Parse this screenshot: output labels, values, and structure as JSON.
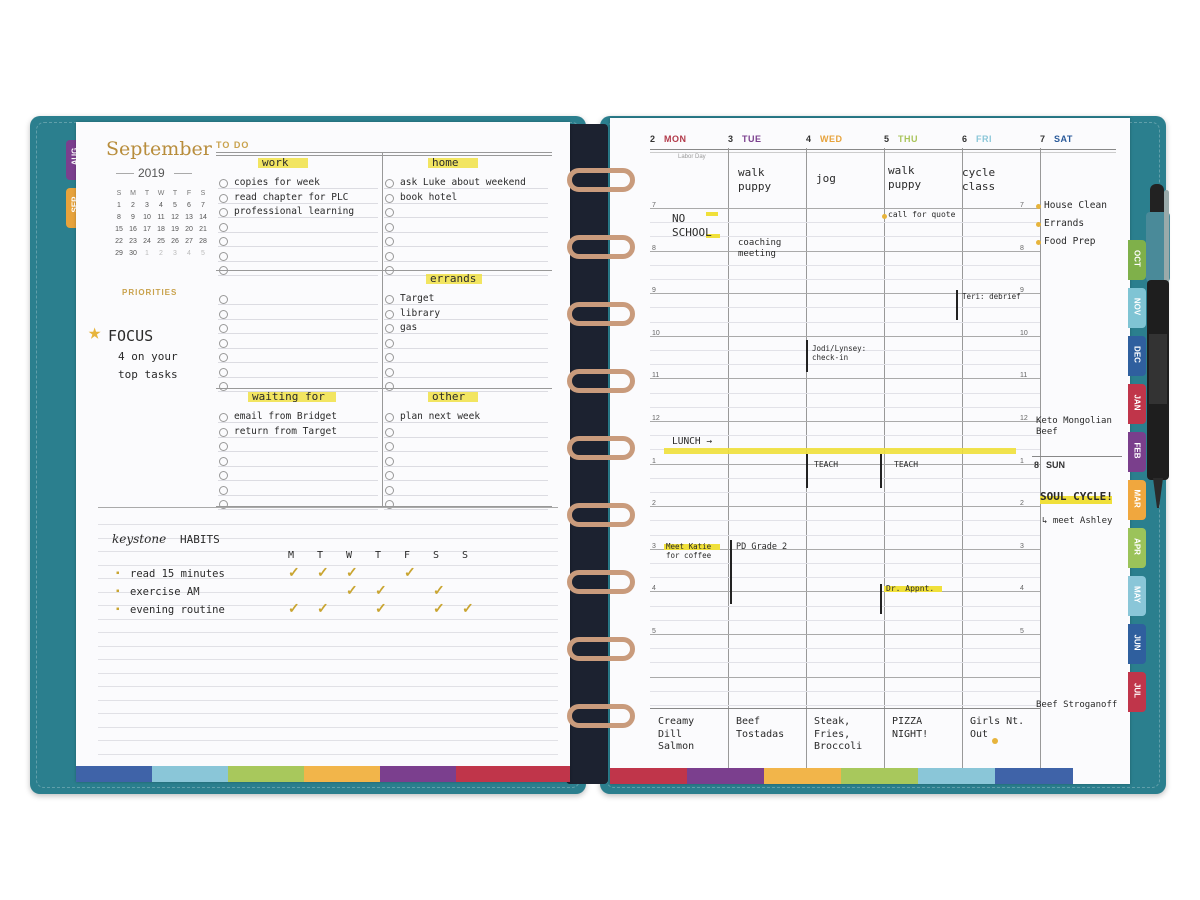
{
  "left_page": {
    "month_title": "September",
    "year": "2019",
    "calendar": {
      "weekdays": [
        "S",
        "M",
        "T",
        "W",
        "T",
        "F",
        "S"
      ],
      "rows": [
        [
          "1",
          "2",
          "3",
          "4",
          "5",
          "6",
          "7"
        ],
        [
          "8",
          "9",
          "10",
          "11",
          "12",
          "13",
          "14"
        ],
        [
          "15",
          "16",
          "17",
          "18",
          "19",
          "20",
          "21"
        ],
        [
          "22",
          "23",
          "24",
          "25",
          "26",
          "27",
          "28"
        ],
        [
          "29",
          "30",
          "1",
          "2",
          "3",
          "4",
          "5"
        ]
      ]
    },
    "todo_label": "TO DO",
    "priorities_label": "PRIORITIES",
    "focus_star": "★",
    "focus_text": "FOCUS",
    "focus_note_1": "4 on your",
    "focus_note_2": "top tasks",
    "sections": {
      "work": {
        "title": "work",
        "items": [
          "copies for week",
          "read chapter for PLC",
          "professional learning"
        ]
      },
      "home": {
        "title": "home",
        "items": [
          "ask Luke about weekend",
          "book hotel"
        ]
      },
      "errands": {
        "title": "errands",
        "items": [
          "Target",
          "library",
          "gas"
        ]
      },
      "waiting": {
        "title": "waiting for",
        "items": [
          "email from Bridget",
          "return from Target"
        ]
      },
      "other": {
        "title": "other",
        "items": [
          "plan next week"
        ]
      }
    },
    "habits": {
      "title_keystone": "keystone",
      "title_habits": "HABITS",
      "days": [
        "M",
        "T",
        "W",
        "T",
        "F",
        "S",
        "S"
      ],
      "rows": [
        {
          "label": "read 15 minutes",
          "checks": [
            1,
            1,
            1,
            0,
            1,
            0,
            0
          ]
        },
        {
          "label": "exercise AM",
          "checks": [
            0,
            0,
            1,
            1,
            0,
            1,
            0
          ]
        },
        {
          "label": "evening routine",
          "checks": [
            1,
            1,
            0,
            1,
            0,
            1,
            1
          ]
        }
      ],
      "check_glyph": "✓",
      "bullet_glyph": "▪"
    }
  },
  "side_tabs_left": [
    {
      "label": "AUG",
      "color": "#7b3f8e"
    },
    {
      "label": "SEP",
      "color": "#e7a33c"
    }
  ],
  "right_page": {
    "days": [
      {
        "num": "2",
        "name": "MON",
        "color": "#b23a4a"
      },
      {
        "num": "3",
        "name": "TUE",
        "color": "#7b3f8e"
      },
      {
        "num": "4",
        "name": "WED",
        "color": "#e7a33c"
      },
      {
        "num": "5",
        "name": "THU",
        "color": "#a9c45a"
      },
      {
        "num": "6",
        "name": "FRI",
        "color": "#8ac6d8"
      },
      {
        "num": "7",
        "name": "SAT",
        "color": "#2a5a9a"
      }
    ],
    "sunday": {
      "num": "8",
      "name": "SUN"
    },
    "labor_day": "Labor Day",
    "hours": [
      "7",
      "8",
      "9",
      "10",
      "11",
      "12",
      "1",
      "2",
      "3",
      "4",
      "5"
    ],
    "entries": {
      "walk_puppy_tue": "walk puppy",
      "jog_wed": "jog",
      "walk_puppy_thu": "walk puppy",
      "cycle_class_fri": "cycle class",
      "no_school": "NO SCHOOL",
      "coaching": "coaching meeting",
      "call_quote": "call for quote",
      "teri": "Teri: debrief",
      "jodi": "Jodi/Lynsey: check-in",
      "lunch": "LUNCH →",
      "teach_wed": "TEACH",
      "teach_thu": "TEACH",
      "meet_katie": "Meet Katie for coffee",
      "pd_grade": "PD Grade 2",
      "dr_appt": "Dr. Appnt."
    },
    "saturday_list": [
      "House Clean",
      "Errands",
      "Food Prep"
    ],
    "saturday_dinner": "Keto Mongolian Beef",
    "sunday_note": "SOUL CYCLE!",
    "sunday_sub": "↳ meet Ashley",
    "sunday_dinner": "Beef Stroganoff",
    "dinners": [
      "Creamy Dill Salmon",
      "Beef Tostadas",
      "Steak, Fries, Broccoli",
      "PIZZA NIGHT!",
      "Girls Nt. Out"
    ]
  },
  "side_tabs_right": [
    {
      "label": "OCT",
      "color": "#7fb04a"
    },
    {
      "label": "NOV",
      "color": "#7fc4d4"
    },
    {
      "label": "DEC",
      "color": "#2f5f9e"
    },
    {
      "label": "JAN",
      "color": "#c0354a"
    },
    {
      "label": "FEB",
      "color": "#7a3f8c"
    },
    {
      "label": "MAR",
      "color": "#f0a73e"
    },
    {
      "label": "APR",
      "color": "#9bc35a"
    },
    {
      "label": "MAY",
      "color": "#8ac6d8"
    },
    {
      "label": "JUN",
      "color": "#2f5f9e"
    },
    {
      "label": "JUL",
      "color": "#c0354a"
    }
  ],
  "colors": {
    "cover": "#2b7f8e",
    "gold": "#c9a24c",
    "highlight": "#f0e03a",
    "ring": "#c99b7c"
  }
}
